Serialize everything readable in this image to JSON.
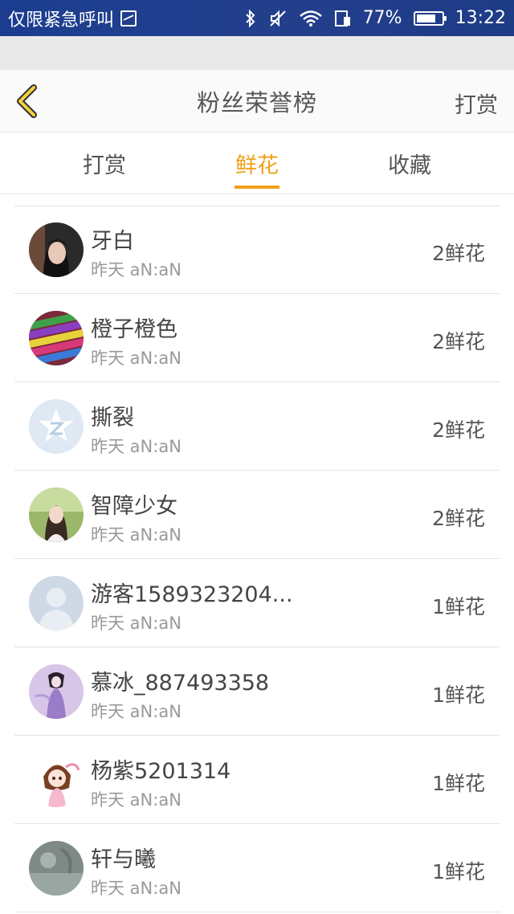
{
  "status_bar": {
    "left_text": "仅限紧急呼叫",
    "battery_percent": "77%",
    "battery_level": 0.77,
    "time": "13:22",
    "icons": [
      "picture-icon",
      "bluetooth-icon",
      "mute-icon",
      "wifi-icon",
      "sim-icon",
      "battery-icon"
    ]
  },
  "header": {
    "title": "粉丝荣誉榜",
    "action": "打赏",
    "back_icon": "chevron-left-icon",
    "accent_color": "#f0a01a"
  },
  "tabs": [
    {
      "label": "打赏",
      "active": false
    },
    {
      "label": "鲜花",
      "active": true
    },
    {
      "label": "收藏",
      "active": false
    }
  ],
  "fans": [
    {
      "name": "牙白",
      "time": "昨天 aN:aN",
      "count": "2鲜花"
    },
    {
      "name": "橙子橙色",
      "time": "昨天 aN:aN",
      "count": "2鲜花"
    },
    {
      "name": "撕裂",
      "time": "昨天 aN:aN",
      "count": "2鲜花"
    },
    {
      "name": "智障少女",
      "time": "昨天 aN:aN",
      "count": "2鲜花"
    },
    {
      "name": "游客1589323204...",
      "time": "昨天 aN:aN",
      "count": "1鲜花"
    },
    {
      "name": "慕冰_887493358",
      "time": "昨天 aN:aN",
      "count": "1鲜花"
    },
    {
      "name": "杨紫5201314",
      "time": "昨天 aN:aN",
      "count": "1鲜花"
    },
    {
      "name": "轩与曦",
      "time": "昨天 aN:aN",
      "count": "1鲜花"
    }
  ]
}
